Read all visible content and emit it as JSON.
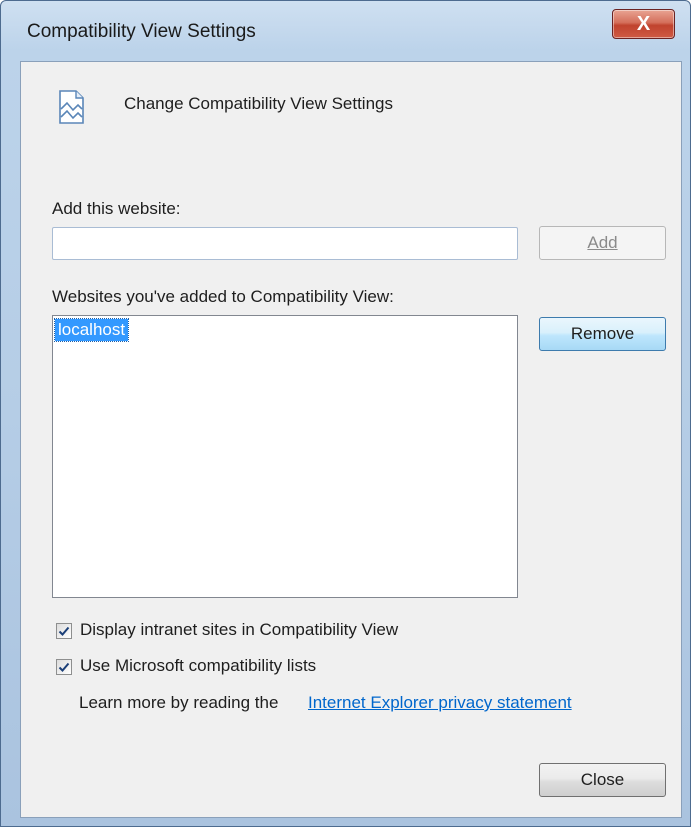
{
  "window": {
    "title": "Compatibility View Settings",
    "close_glyph": "X"
  },
  "header": {
    "icon": "compatibility-view-icon",
    "text": "Change Compatibility View Settings"
  },
  "add_site": {
    "label": "Add this website:",
    "input_value": "",
    "add_button_label": "Add",
    "add_button_enabled": false
  },
  "added_sites": {
    "label": "Websites you've added to Compatibility View:",
    "items": [
      "localhost"
    ],
    "selected_index": 0,
    "remove_button_label": "Remove"
  },
  "options": [
    {
      "label": "Display intranet sites in Compatibility View",
      "checked": true
    },
    {
      "label": "Use Microsoft compatibility lists",
      "checked": true
    }
  ],
  "privacy": {
    "prefix": "Learn more by reading the ",
    "link_text": "Internet Explorer privacy statement"
  },
  "footer": {
    "close_button_label": "Close"
  },
  "colors": {
    "selection": "#3399ff",
    "link": "#0066cc",
    "dialog_bg": "#f0f0f0"
  }
}
